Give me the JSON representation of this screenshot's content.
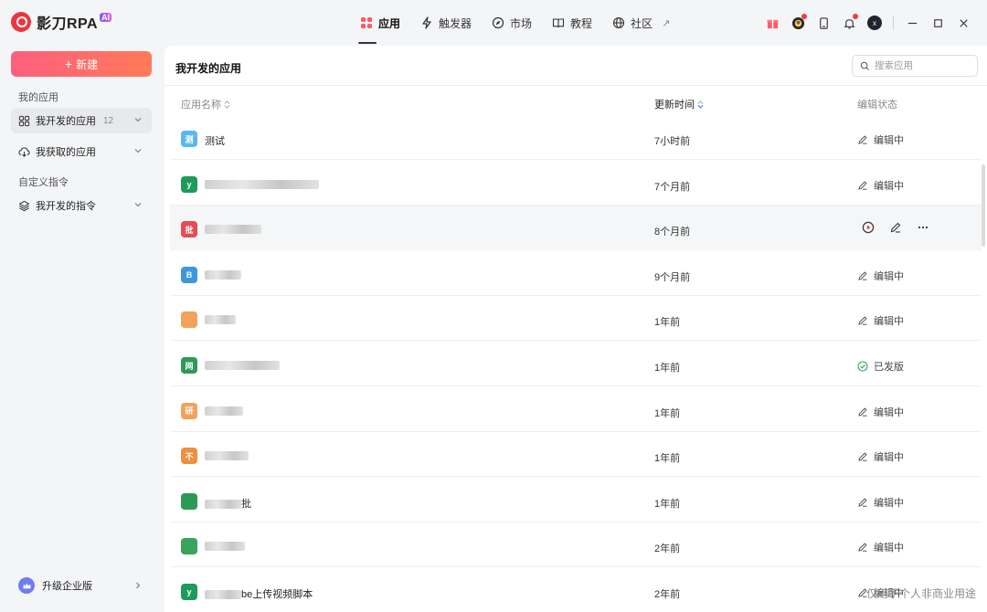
{
  "app": {
    "name": "影刀RPA",
    "badge": "AI"
  },
  "topnav": [
    {
      "label": "应用",
      "icon": "apps-grid-icon",
      "active": true
    },
    {
      "label": "触发器",
      "icon": "lightning-icon"
    },
    {
      "label": "市场",
      "icon": "compass-icon"
    },
    {
      "label": "教程",
      "icon": "book-icon"
    },
    {
      "label": "社区",
      "icon": "globe-icon",
      "external": "↗"
    }
  ],
  "titlebar": {
    "avatar_letter": "x"
  },
  "sidebar": {
    "new_button": "新建",
    "section_my_apps": "我的应用",
    "items": [
      {
        "label": "我开发的应用",
        "count": "12"
      },
      {
        "label": "我获取的应用"
      }
    ],
    "section_commands": "自定义指令",
    "command_item": "我开发的指令",
    "upgrade": "升级企业版"
  },
  "main": {
    "title": "我开发的应用",
    "search_placeholder": "搜索应用",
    "columns": {
      "name": "应用名称",
      "updated": "更新时间",
      "status": "编辑状态"
    },
    "rows": [
      {
        "icon_char": "测",
        "icon_color": "#5ab8f0",
        "name": "测试",
        "blur": 0,
        "time": "7小时前",
        "status": "编辑中"
      },
      {
        "icon_char": "y",
        "icon_color": "#1e9a5a",
        "name": "",
        "blur": 125,
        "time": "7个月前",
        "status": "编辑中"
      },
      {
        "icon_char": "批",
        "icon_color": "#e94b55",
        "name": "",
        "blur": 62,
        "time": "8个月前",
        "status": "",
        "hover": true
      },
      {
        "icon_char": "B",
        "icon_color": "#3d97dc",
        "name": "",
        "blur": 40,
        "time": "9个月前",
        "status": "编辑中"
      },
      {
        "icon_char": "",
        "icon_color": "#f2a25c",
        "name": "",
        "blur": 34,
        "time": "1年前",
        "status": "编辑中"
      },
      {
        "icon_char": "网",
        "icon_color": "#2c9a55",
        "name": "",
        "blur": 82,
        "time": "1年前",
        "status": "已发版",
        "published": true
      },
      {
        "icon_char": "研",
        "icon_color": "#f2a25c",
        "name": "",
        "blur": 42,
        "time": "1年前",
        "status": "编辑中"
      },
      {
        "icon_char": "不",
        "icon_color": "#ef8e3c",
        "name": "",
        "blur": 48,
        "time": "1年前",
        "status": "编辑中"
      },
      {
        "icon_char": "",
        "icon_color": "#2c9a55",
        "name": "批",
        "blur": 40,
        "time": "1年前",
        "status": "编辑中"
      },
      {
        "icon_char": "",
        "icon_color": "#3aa35c",
        "name": "",
        "blur": 44,
        "time": "2年前",
        "status": "编辑中"
      },
      {
        "icon_char": "y",
        "icon_color": "#1e9a5a",
        "name": "be上传视频脚本",
        "blur": 40,
        "time": "2年前",
        "status": "编辑中"
      }
    ]
  },
  "watermark": "仅用于个人非商业用途"
}
